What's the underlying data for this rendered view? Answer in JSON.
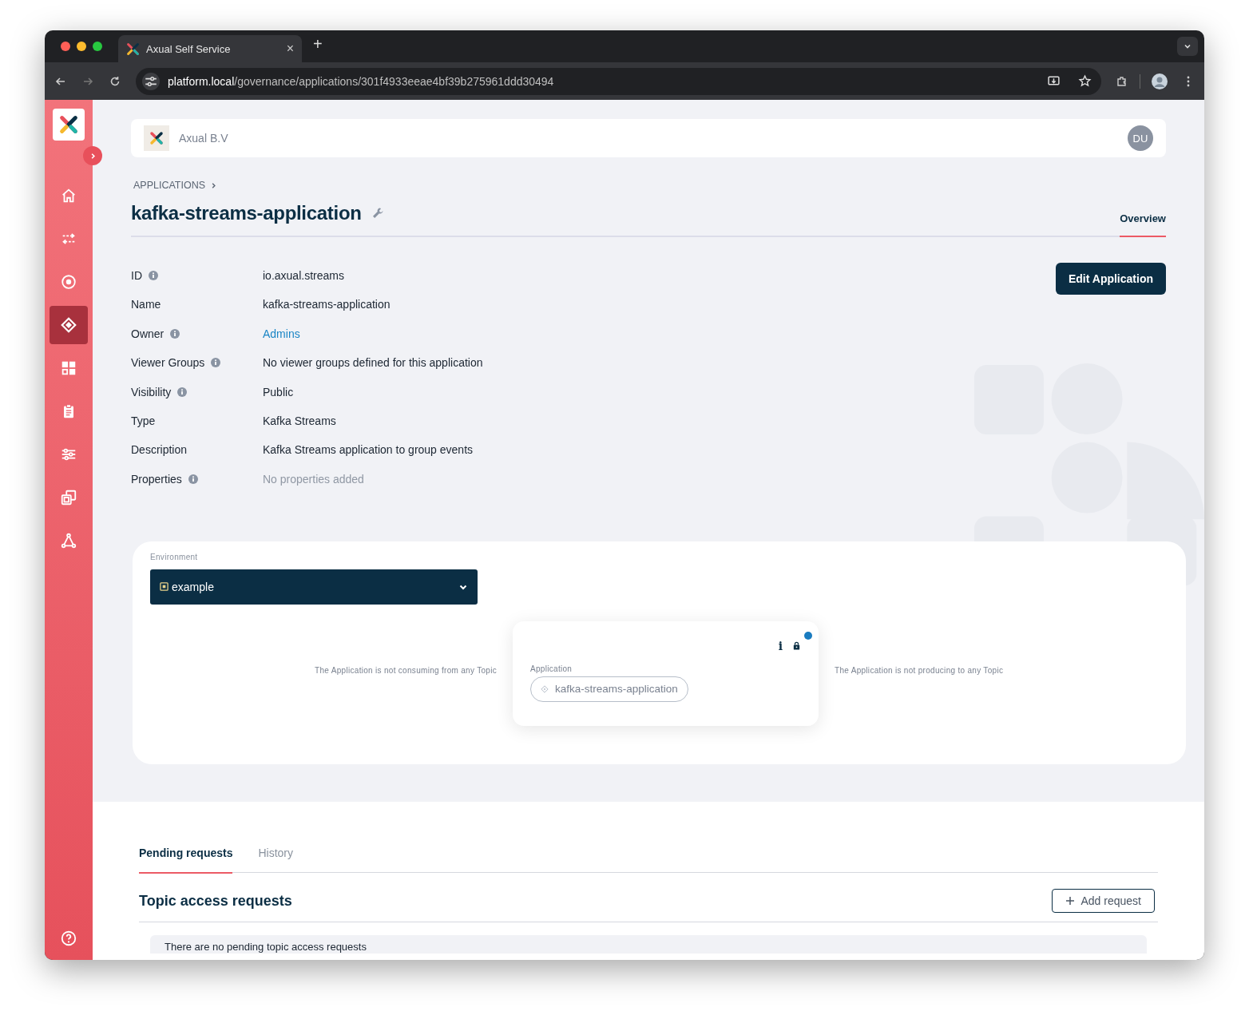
{
  "browser": {
    "tab_title": "Axual Self Service",
    "tab_close": "×",
    "new_tab": "+",
    "url_host": "platform.local",
    "url_path": "/governance/applications/301f4933eeae4bf39b275961ddd30494"
  },
  "sidebar": {
    "items": [
      {
        "selected": false
      },
      {
        "selected": false
      },
      {
        "selected": false
      },
      {
        "selected": true
      },
      {
        "selected": false
      },
      {
        "selected": false
      },
      {
        "selected": false
      },
      {
        "selected": false
      },
      {
        "selected": false
      }
    ]
  },
  "header": {
    "organization": "Axual B.V",
    "avatar": "DU"
  },
  "breadcrumb": "APPLICATIONS",
  "title": "kafka-streams-application",
  "tabs": [
    {
      "label": "Overview",
      "selected": true
    }
  ],
  "edit_button": "Edit Application",
  "details": [
    {
      "label": "ID",
      "info": true,
      "value": "io.axual.streams",
      "kind": "text"
    },
    {
      "label": "Name",
      "info": false,
      "value": "kafka-streams-application",
      "kind": "text"
    },
    {
      "label": "Owner",
      "info": true,
      "value": "Admins",
      "kind": "link"
    },
    {
      "label": "Viewer Groups",
      "info": true,
      "value": "No viewer groups defined for this application",
      "kind": "text"
    },
    {
      "label": "Visibility",
      "info": true,
      "value": "Public",
      "kind": "text"
    },
    {
      "label": "Type",
      "info": false,
      "value": "Kafka Streams",
      "kind": "text"
    },
    {
      "label": "Description",
      "info": false,
      "value": "Kafka Streams application to group events",
      "kind": "text"
    },
    {
      "label": "Properties",
      "info": true,
      "value": "No properties added",
      "kind": "muted"
    }
  ],
  "environment": {
    "label": "Environment",
    "value": "example"
  },
  "graph": {
    "consumer_note": "The Application is not consuming from any Topic",
    "producer_note": "The Application is not producing to any Topic",
    "node": {
      "info": "i",
      "lock_badge": true,
      "label": "Application",
      "name": "kafka-streams-application"
    }
  },
  "requests": {
    "tabs": [
      {
        "label": "Pending requests",
        "selected": true
      },
      {
        "label": "History",
        "selected": false
      }
    ],
    "heading": "Topic access requests",
    "add_button": "Add request",
    "empty_message": "There are no pending topic access requests"
  }
}
